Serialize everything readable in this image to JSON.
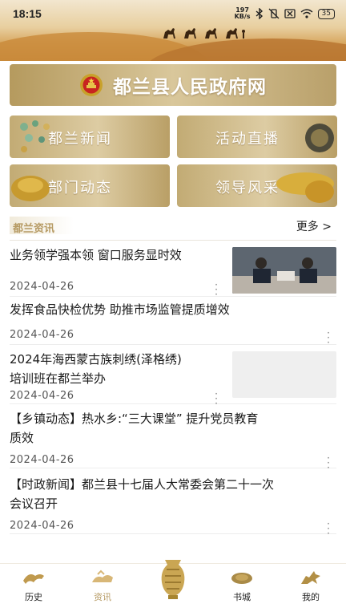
{
  "status_bar": {
    "time": "18:15",
    "net_speed_top": "197",
    "net_speed_unit": "KB/s",
    "battery": "35",
    "icons": [
      "bluetooth-icon",
      "vibrate-off-icon",
      "sim-x-icon",
      "wifi-icon",
      "battery-icon"
    ]
  },
  "header": {
    "title": "都兰县人民政府网",
    "emblem_icon": "national-emblem-icon"
  },
  "tiles": [
    {
      "label": "都兰新闻"
    },
    {
      "label": "活动直播"
    },
    {
      "label": "部门动态"
    },
    {
      "label": "领导风采"
    }
  ],
  "section": {
    "title": "都兰资讯",
    "more": "更多 >"
  },
  "news": [
    {
      "title": "业务领学强本领  窗口服务显时效",
      "date": "2024-04-26",
      "thumb": "photo"
    },
    {
      "title": "发挥食品快检优势  助推市场监管提质增效",
      "date": "2024-04-26"
    },
    {
      "title": "2024年海西蒙古族刺绣(泽格绣)",
      "title2": "培训班在都兰举办",
      "date": "2024-04-26",
      "thumb": "blank"
    },
    {
      "title": "【乡镇动态】热水乡:“三大课堂” 提升党员教育",
      "title2": "质效",
      "date": "2024-04-26"
    },
    {
      "title": "【时政新闻】都兰县十七届人大常委会第二十一次",
      "title2": "会议召开",
      "date": "2024-04-26"
    }
  ],
  "bottom_nav": [
    {
      "label": "历史",
      "icon": "history-icon"
    },
    {
      "label": "资讯",
      "icon": "news-icon"
    },
    {
      "label": "书城",
      "icon": "bookstore-icon"
    },
    {
      "label": "我的",
      "icon": "profile-icon"
    }
  ],
  "colors": {
    "gold": "#b69a63",
    "title_text": "#ffffff"
  }
}
